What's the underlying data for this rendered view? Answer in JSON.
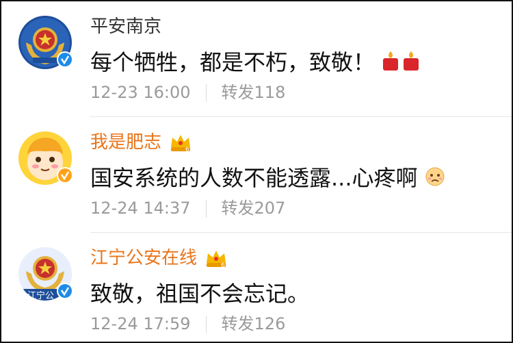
{
  "comments": [
    {
      "user": "平安南京",
      "vip": false,
      "avatar": "police-badge-avatar",
      "text": "每个牺牲，都是不朽，致敬！",
      "emoji": "candle-emoji",
      "time": "12-23 16:00",
      "repost": "转发118"
    },
    {
      "user": "我是肥志",
      "vip": true,
      "avatar": "cartoon-avatar",
      "text": "国安系统的人数不能透露...心疼啊",
      "emoji": "sad-face-emoji",
      "time": "12-24 14:37",
      "repost": "转发207"
    },
    {
      "user": "江宁公安在线",
      "vip": true,
      "avatar": "police-badge-avatar",
      "avatar_caption": "江宁公",
      "text": "致敬，祖国不会忘记。",
      "time": "12-24 17:59",
      "repost": "转发126"
    }
  ],
  "colors": {
    "vip_name": "#e8751a",
    "meta": "#9a9a9a",
    "verified": "#ffa21a"
  }
}
